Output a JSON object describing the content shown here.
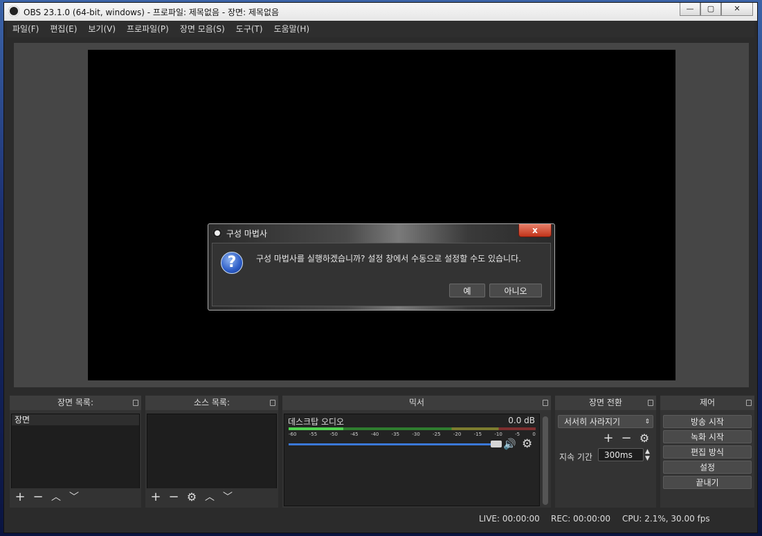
{
  "window": {
    "title": "OBS 23.1.0 (64-bit, windows) - 프로파일: 제목없음 - 장면: 제목없음",
    "min": "—",
    "max": "▢",
    "close": "✕"
  },
  "menu": [
    "파일(F)",
    "편집(E)",
    "보기(V)",
    "프로파일(P)",
    "장면 모음(S)",
    "도구(T)",
    "도움말(H)"
  ],
  "scenes": {
    "title": "장면 목록:",
    "items": [
      "장면"
    ]
  },
  "sources": {
    "title": "소스 목록:"
  },
  "mixer": {
    "title": "믹서",
    "track_name": "데스크탑 오디오",
    "db": "0.0 dB",
    "ticks": [
      "-60",
      "-55",
      "-50",
      "-45",
      "-40",
      "-35",
      "-30",
      "-25",
      "-20",
      "-15",
      "-10",
      "-5",
      "0"
    ],
    "level_fraction": 0.22,
    "volume_fraction": 1.0
  },
  "transitions": {
    "title": "장면 전환",
    "selected": "서서히 사라지기",
    "duration_label": "지속 기간",
    "duration_value": "300ms"
  },
  "controls": {
    "title": "제어",
    "buttons": [
      "방송 시작",
      "녹화 시작",
      "편집 방식",
      "설정",
      "끝내기"
    ]
  },
  "status": {
    "live": "LIVE: 00:00:00",
    "rec": "REC: 00:00:00",
    "cpu": "CPU: 2.1%, 30.00 fps"
  },
  "dialog": {
    "title": "구성 마법사",
    "message": "구성 마법사를 실행하겠습니까? 설정 창에서 수동으로 설정할 수도 있습니다.",
    "yes": "예",
    "no": "아니오",
    "close": "x"
  }
}
